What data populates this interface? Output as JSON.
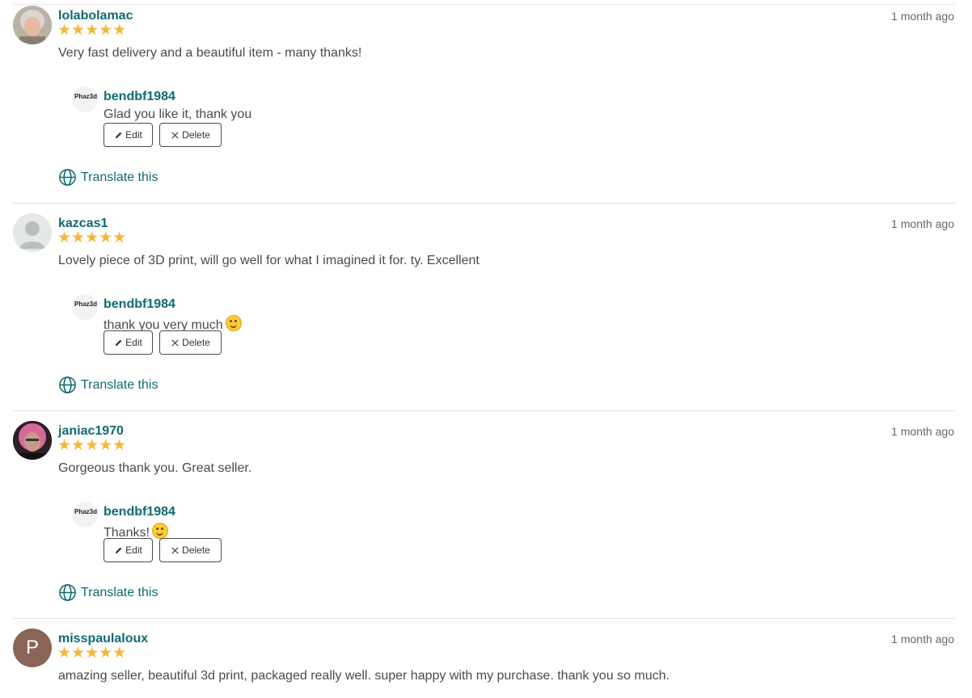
{
  "reviews": [
    {
      "username": "lolabolamac",
      "stars": "★★★★★",
      "time": "1 month ago",
      "text": "Very fast delivery and a beautiful item - many thanks!",
      "reply": {
        "username": "bendbf1984",
        "text": "Glad you like it, thank you",
        "emoji": false
      },
      "avatar": "photo-grey-hair"
    },
    {
      "username": "kazcas1",
      "stars": "★★★★★",
      "time": "1 month ago",
      "text": "Lovely piece of 3D print, will go well for what I imagined it for. ty. Excellent",
      "reply": {
        "username": "bendbf1984",
        "text": "thank you very much",
        "emoji": true
      },
      "avatar": "default-person"
    },
    {
      "username": "janiac1970",
      "stars": "★★★★★",
      "time": "1 month ago",
      "text": "Gorgeous thank you. Great seller.",
      "reply": {
        "username": "bendbf1984",
        "text": "Thanks!",
        "emoji": true
      },
      "avatar": "photo-pink-hair"
    },
    {
      "username": "misspaulaloux",
      "stars": "★★★★★",
      "time": "1 month ago",
      "text": "amazing seller, beautiful 3d print, packaged really well. super happy with my purchase. thank you so much.",
      "avatar_letter": "P",
      "avatar": "letter"
    }
  ],
  "buttons": {
    "edit": "Edit",
    "delete": "Delete"
  },
  "translate_label": "Translate this",
  "seller_logo_text": "Phaz3d",
  "colors": {
    "accent": "#0f6b6f",
    "star": "#f4b73b",
    "letter_avatar_bg": "#8a6457"
  }
}
